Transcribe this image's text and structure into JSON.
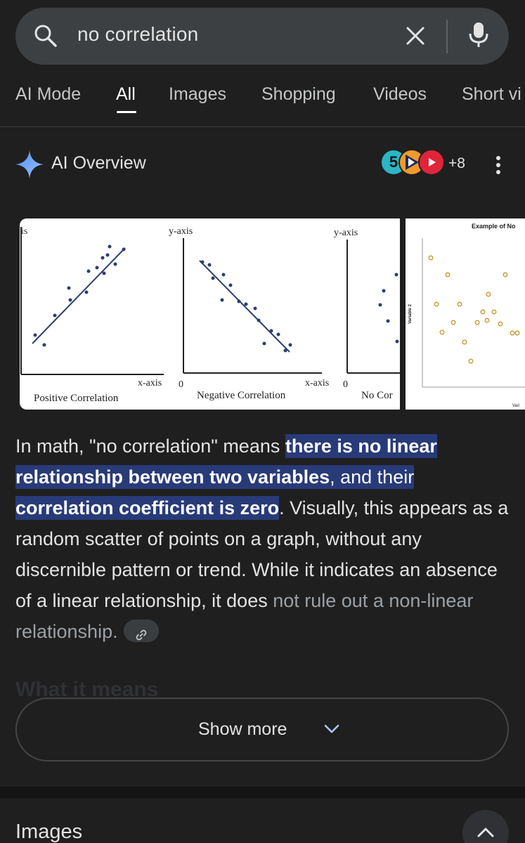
{
  "search": {
    "query": "no correlation"
  },
  "tabs": [
    {
      "label": "AI Mode"
    },
    {
      "label": "All"
    },
    {
      "label": "Images"
    },
    {
      "label": "Shopping"
    },
    {
      "label": "Videos"
    },
    {
      "label": "Short vi"
    }
  ],
  "active_tab": "All",
  "ai_overview": {
    "title": "AI Overview",
    "source_badge_number": "5",
    "sources_more": "+8",
    "paragraph": {
      "p1": "In math, \"no correlation\" means ",
      "highlight": "there is no linear relationship between two variables",
      "p2": ", and their ",
      "highlight2": "correlation coefficient is zero",
      "p3": ". Visually, this appears as a random scatter of points on a graph, without any discernible pattern or trend. While it indicates an absence of a linear relationship, it does ",
      "fade": "not rule out a non-linear relationship."
    },
    "ghost_heading": "What it means",
    "show_more": "Show more"
  },
  "image_a": {
    "left_partial_label": "is",
    "y_axis_1": "y-axis",
    "x_axis_1": "x-axis",
    "origin_1": "0",
    "caption_1": "Positive Correlation",
    "y_axis_2": "y-axis",
    "x_axis_2": "x-axis",
    "origin_2": "0",
    "caption_2": "Negative Correlation",
    "caption_3": "No Cor"
  },
  "image_b": {
    "title": "Example of No",
    "y_label": "Variable 2",
    "x_label": "Vari"
  },
  "images_section": {
    "heading": "Images"
  },
  "colors": {
    "background": "#1f1f1f",
    "search_bg": "#3c4043",
    "highlight": "#283a78",
    "scatter_orange": "#c9962b",
    "scatter_navy": "#2d3f6e"
  }
}
